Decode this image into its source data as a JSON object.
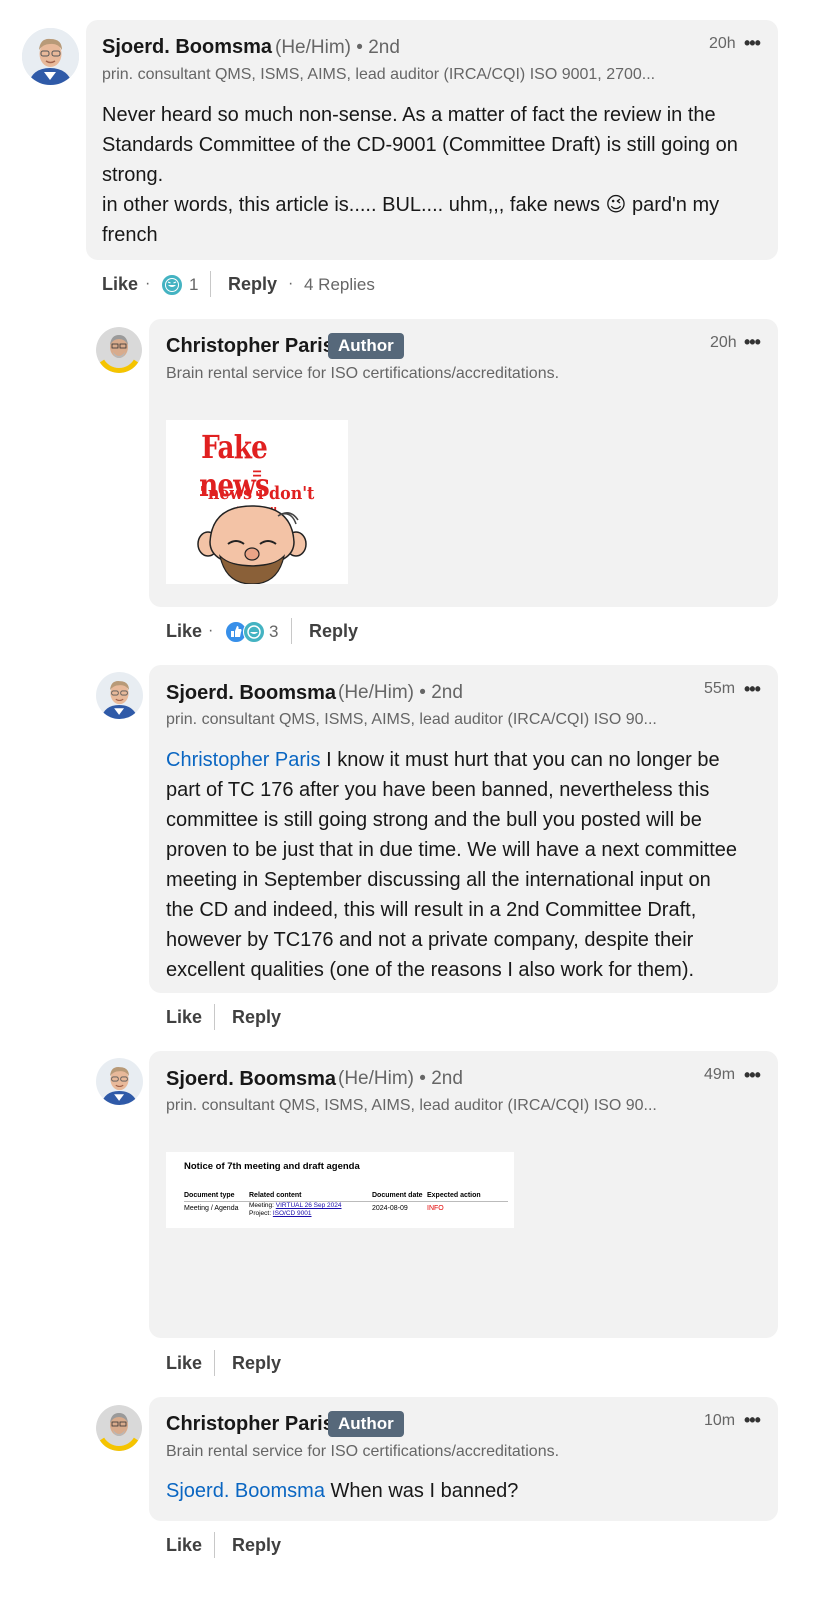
{
  "comment1": {
    "name": "Sjoerd. Boomsma",
    "pronouns": "(He/Him) • 2nd",
    "headline": "prin. consultant QMS, ISMS, AIMS, lead auditor (IRCA/CQI) ISO 9001, 2700...",
    "time": "20h",
    "line1": "Never heard so much non-sense. As a matter of fact the review in the",
    "line2": "Standards Committee of the CD-9001 (Committee Draft) is still going on",
    "line3": "strong.",
    "line4a": "in other words, this article is..... BUL.... uhm,,, fake news",
    "emoji": "😉",
    "line4b": "pard'n my",
    "line5": "french",
    "like": "Like",
    "reaction_count": "1",
    "reply": "Reply",
    "replies": "4 Replies"
  },
  "reply1": {
    "name": "Christopher Paris",
    "badge": "Author",
    "headline": "Brain rental service for ISO certifications/accreditations.",
    "time": "20h",
    "image": {
      "title": "Fake news",
      "equals": "=",
      "subtitle": "\"news i don't like\""
    },
    "like": "Like",
    "reaction_count": "3",
    "reply": "Reply"
  },
  "reply2": {
    "name": "Sjoerd. Boomsma",
    "pronouns": "(He/Him) • 2nd",
    "headline": "prin. consultant QMS, ISMS, AIMS, lead auditor (IRCA/CQI) ISO 90...",
    "time": "55m",
    "mention": "Christopher Paris",
    "line1": "I know it must hurt that you can no longer be",
    "line2": "part of TC 176 after you have been banned, nevertheless this",
    "line3": "committee is still going strong and the bull you posted will be",
    "line4": "proven to be just that in due time. We will have a next committee",
    "line5": "meeting in September discussing all the international input on",
    "line6": "the CD and indeed, this will result in a 2nd Committee Draft,",
    "line7": "however by TC176 and not a private company, despite their",
    "line8": "excellent qualities (one of the reasons I also work for them).",
    "like": "Like",
    "reply": "Reply"
  },
  "reply3": {
    "name": "Sjoerd. Boomsma",
    "pronouns": "(He/Him) • 2nd",
    "headline": "prin. consultant QMS, ISMS, AIMS, lead auditor (IRCA/CQI) ISO 90...",
    "time": "49m",
    "doc": {
      "title": "Notice of 7th meeting and draft agenda",
      "col_type": "Document type",
      "col_related": "Related content",
      "col_date": "Document date",
      "col_action": "Expected action",
      "type_value": "Meeting / Agenda",
      "meeting_label": "Meeting:",
      "meeting_link": "VIRTUAL 26 Sep 2024",
      "project_label": "Project:",
      "project_link": "ISO/CD 9001",
      "date_value": "2024-08-09",
      "action_value": "INFO"
    },
    "like": "Like",
    "reply": "Reply"
  },
  "reply4": {
    "name": "Christopher Paris",
    "badge": "Author",
    "headline": "Brain rental service for ISO certifications/accreditations.",
    "time": "10m",
    "mention": "Sjoerd. Boomsma",
    "text": "When was I banned?",
    "like": "Like",
    "reply": "Reply"
  },
  "more_icon": "•••",
  "colors": {
    "bubble": "#f2f2f2",
    "mention": "#0a66c2",
    "author_badge": "#56687a",
    "muted": "#666666"
  }
}
